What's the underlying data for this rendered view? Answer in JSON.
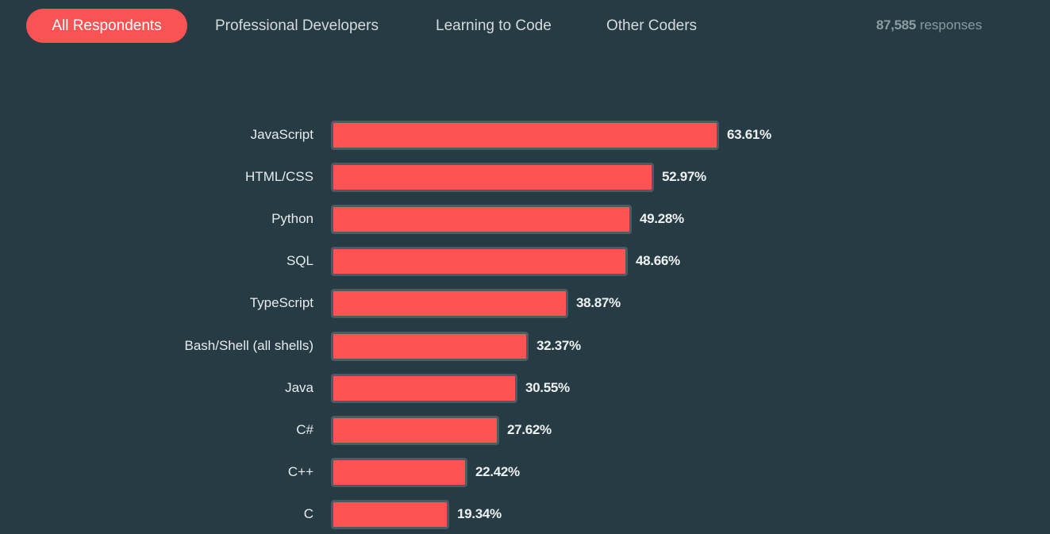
{
  "tabs": [
    {
      "label": "All Respondents",
      "active": true
    },
    {
      "label": "Professional Developers",
      "active": false
    },
    {
      "label": "Learning to Code",
      "active": false
    },
    {
      "label": "Other Coders",
      "active": false
    }
  ],
  "responses": {
    "count": "87,585",
    "label": "responses"
  },
  "colors": {
    "background": "#263b43",
    "accent": "#f95353",
    "bar_fill": "#ff5252",
    "bar_border": "#4c5c63"
  },
  "chart_data": {
    "type": "bar",
    "orientation": "horizontal",
    "title": "",
    "xlabel": "",
    "ylabel": "",
    "xlim": [
      0,
      100
    ],
    "grid": false,
    "unit": "%",
    "categories": [
      "JavaScript",
      "HTML/CSS",
      "Python",
      "SQL",
      "TypeScript",
      "Bash/Shell (all shells)",
      "Java",
      "C#",
      "C++",
      "C"
    ],
    "values": [
      63.61,
      52.97,
      49.28,
      48.66,
      38.87,
      32.37,
      30.55,
      27.62,
      22.42,
      19.34
    ],
    "value_labels": [
      "63.61%",
      "52.97%",
      "49.28%",
      "48.66%",
      "38.87%",
      "32.37%",
      "30.55%",
      "27.62%",
      "22.42%",
      "19.34%"
    ]
  }
}
